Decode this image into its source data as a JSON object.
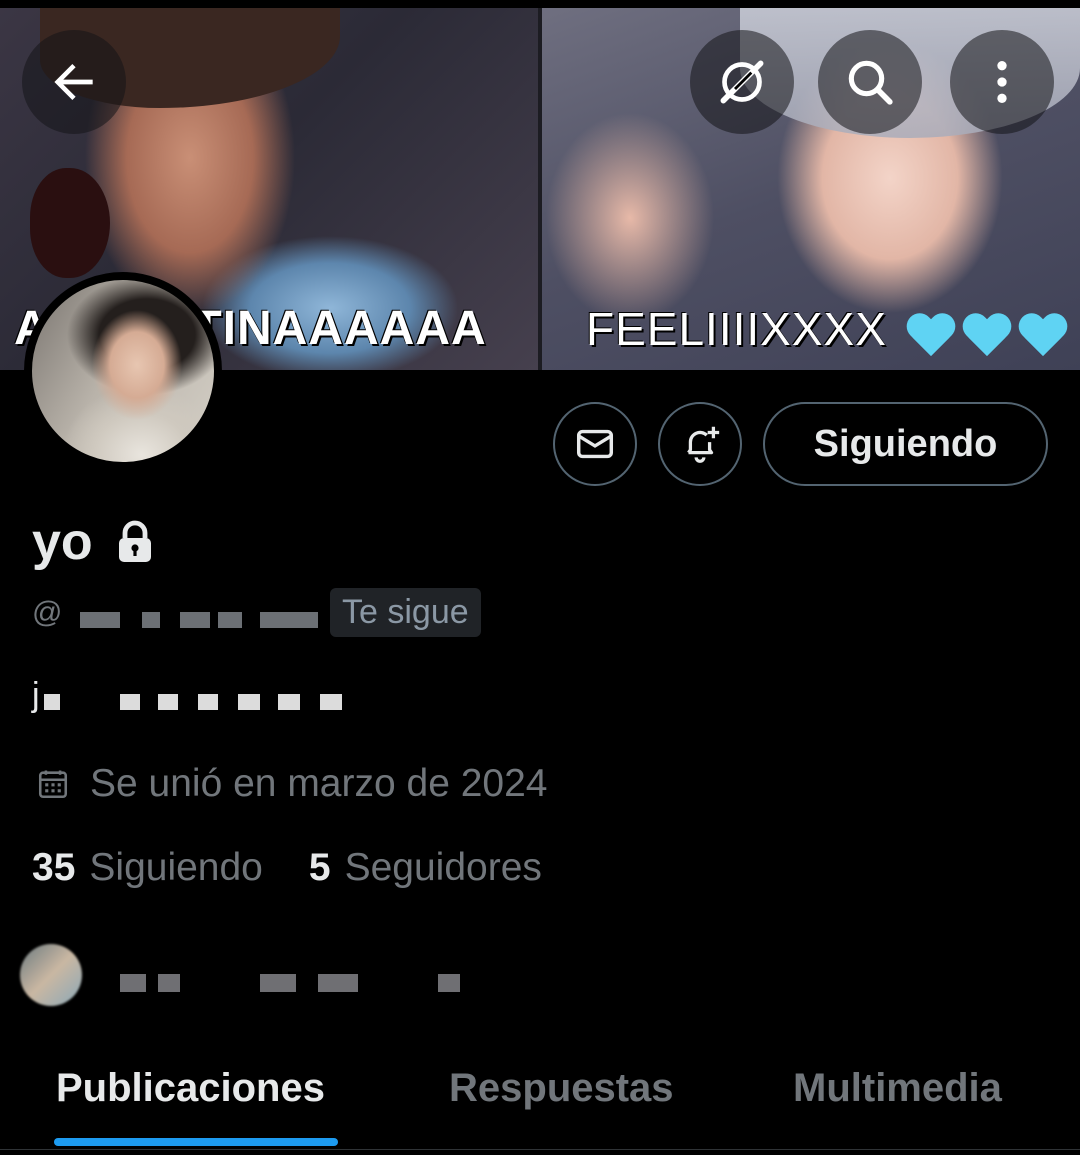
{
  "banner": {
    "left_text": "ARGENTINAAAAAA",
    "right_text": "FEELIIIIXXXX",
    "hearts": [
      "💙",
      "💙",
      "💙"
    ],
    "heart_color": "#5fd3f3"
  },
  "top_bar": {
    "back_icon": "arrow-left-icon",
    "grok_icon": "grok-icon",
    "search_icon": "search-icon",
    "more_icon": "more-vertical-icon"
  },
  "actions": {
    "message_icon": "envelope-icon",
    "notify_icon": "bell-plus-icon",
    "following_label": "Siguiendo"
  },
  "profile": {
    "name": "yo",
    "locked": true,
    "handle_prefix": "@",
    "follows_you_badge": "Te sigue",
    "bio_first_char": "j",
    "joined": "Se unió en marzo de 2024"
  },
  "stats": {
    "following_count": "35",
    "following_label": "Siguiendo",
    "followers_count": "5",
    "followers_label": "Seguidores"
  },
  "tabs": [
    {
      "label": "Publicaciones",
      "active": true
    },
    {
      "label": "Respuestas",
      "active": false
    },
    {
      "label": "Multimedia",
      "active": false
    }
  ],
  "colors": {
    "accent": "#1d9bf0",
    "text_primary": "#e7e9ea",
    "text_secondary": "#71767b",
    "border": "#536471",
    "background": "#000000"
  }
}
